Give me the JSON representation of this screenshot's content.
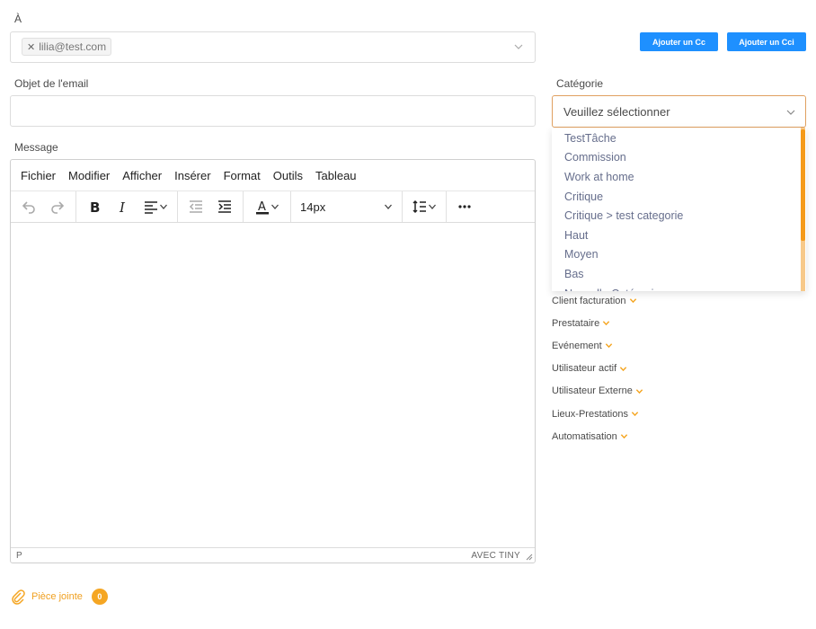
{
  "to": {
    "label": "À",
    "recipients": [
      "lilia@test.com"
    ],
    "remove_glyph": "✕"
  },
  "buttons": {
    "add_cc": "Ajouter un Cc",
    "add_cci": "Ajouter un Cci"
  },
  "subject": {
    "label": "Objet de l'email",
    "value": ""
  },
  "category": {
    "label": "Catégorie",
    "selected": "Veuillez sélectionner",
    "options": [
      "TestTâche",
      "Commission",
      "Work at home",
      "Critique",
      "Critique > test categorie",
      "Haut",
      "Moyen",
      "Bas",
      "Nouvelle Catégorie"
    ]
  },
  "variables": [
    "Client facturation",
    "Prestataire",
    "Evénement",
    "Utilisateur actif",
    "Utilisateur Externe",
    "Lieux-Prestations",
    "Automatisation"
  ],
  "message": {
    "label": "Message",
    "menu": [
      "Fichier",
      "Modifier",
      "Afficher",
      "Insérer",
      "Format",
      "Outils",
      "Tableau"
    ],
    "font_size": "14px",
    "status_path": "P",
    "status_brand": "AVEC TINY"
  },
  "attachment": {
    "label": "Pièce jointe",
    "count": "0"
  },
  "colors": {
    "accent_blue": "#1e90ff",
    "accent_orange": "#f5a623",
    "select_border": "#e0a060"
  }
}
